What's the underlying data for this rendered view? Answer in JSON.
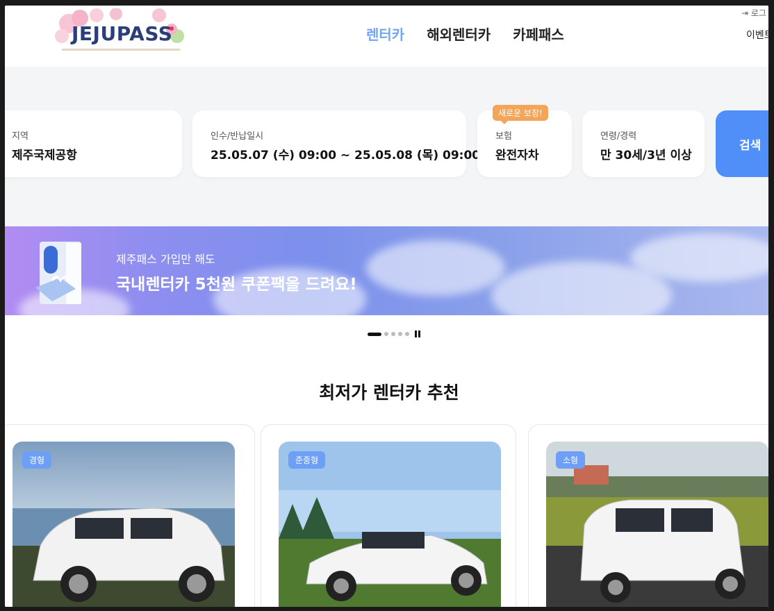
{
  "header": {
    "logo_text": "JEJUPASS",
    "nav": [
      {
        "label": "렌터카",
        "active": true
      },
      {
        "label": "해외렌터카",
        "active": false
      },
      {
        "label": "카페패스",
        "active": false
      }
    ],
    "login_label": "로그",
    "event_label": "이벤트"
  },
  "search": {
    "region": {
      "label": "지역",
      "value": "제주국제공항"
    },
    "datetime": {
      "label": "인수/반납일시",
      "value": "25.05.07 (수) 09:00 ~ 25.05.08 (목) 09:00"
    },
    "insurance": {
      "label": "보험",
      "value": "완전자차",
      "badge": "새로운 보장!"
    },
    "age": {
      "label": "연령/경력",
      "value": "만 30세/3년 이상"
    },
    "button_label": "검색"
  },
  "banner": {
    "subtitle": "제주패스 가입만 해도",
    "title": "국내렌터카 5천원 쿠폰팩을 드려요!"
  },
  "pager": {
    "total": 5,
    "current": 1
  },
  "section": {
    "title": "최저가 렌터카 추천"
  },
  "cars": [
    {
      "tag": "경형"
    },
    {
      "tag": "준중형"
    },
    {
      "tag": "소형"
    }
  ],
  "colors": {
    "accent": "#4f8ff7",
    "nav_active": "#6fa6f7",
    "badge": "#f3a55a",
    "tag": "#6d9ff7"
  }
}
